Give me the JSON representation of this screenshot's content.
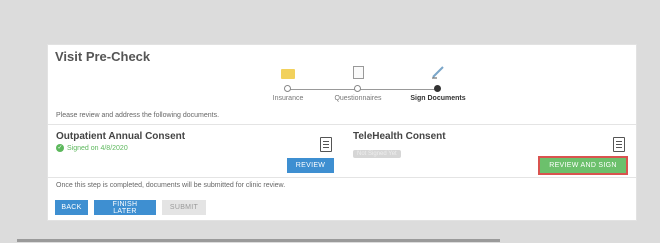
{
  "title": "Visit Pre-Check",
  "steps": [
    {
      "label": "Insurance",
      "icon": "card-icon"
    },
    {
      "label": "Questionnaires",
      "icon": "clipboard-icon"
    },
    {
      "label": "Sign Documents",
      "icon": "pen-icon"
    }
  ],
  "instructions": "Please review and address the following documents.",
  "documents": [
    {
      "name": "Outpatient Annual Consent",
      "status": "Signed on 4/8/2020",
      "button": "REVIEW"
    },
    {
      "name": "TeleHealth Consent",
      "status": "Not Signed Yet",
      "button": "REVIEW AND SIGN"
    }
  ],
  "footer_note": "Once this step is completed, documents will be submitted for clinic review.",
  "actions": {
    "back": "BACK",
    "finish_later": "FINISH LATER",
    "submit": "SUBMIT"
  },
  "colors": {
    "primary": "#3e8fd1",
    "success": "#5cb85c",
    "highlight": "#d9534f",
    "insurance_icon": "#f2d15c"
  }
}
